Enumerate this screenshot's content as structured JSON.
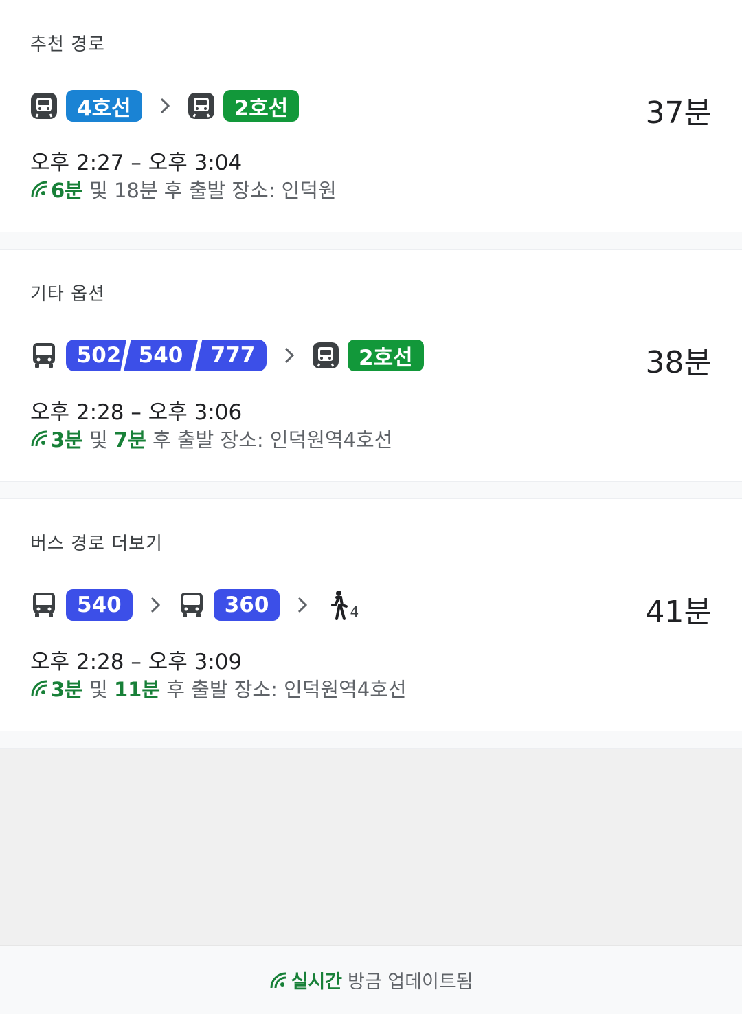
{
  "sections": [
    {
      "title": "추천 경로",
      "duration": "37분",
      "time_range": "오후 2:27 – 오후 3:04",
      "live": {
        "first": "6분",
        "and": " 및 ",
        "second": "18분",
        "suffix": " 후 출발 장소: 인덕원"
      },
      "legs": [
        "subway",
        "4호선",
        "subway",
        "2호선"
      ]
    },
    {
      "title": "기타 옵션",
      "duration": "38분",
      "time_range": "오후 2:28 – 오후 3:06",
      "live": {
        "first": "3분",
        "and": " 및 ",
        "second": "7분",
        "suffix": " 후 출발 장소: 인덕원역4호선"
      },
      "bus_numbers": [
        "502",
        "540",
        "777"
      ],
      "second_line": "2호선"
    },
    {
      "title": "버스 경로 더보기",
      "duration": "41분",
      "time_range": "오후 2:28 – 오후 3:09",
      "live": {
        "first": "3분",
        "and": " 및 ",
        "second": "11분",
        "suffix": " 후 출발 장소: 인덕원역4호선"
      },
      "bus_a": "540",
      "bus_b": "360",
      "walk_minutes": "4"
    }
  ],
  "footer": {
    "live_label": "실시간",
    "status": "방금 업데이트됨"
  },
  "colors": {
    "line4": "#1a83d4",
    "line2": "#12983a",
    "bus": "#3c4fe8",
    "live_green": "#188038"
  },
  "icons": [
    "subway-icon",
    "bus-icon",
    "chevron-right-icon",
    "walk-icon",
    "realtime-icon"
  ]
}
